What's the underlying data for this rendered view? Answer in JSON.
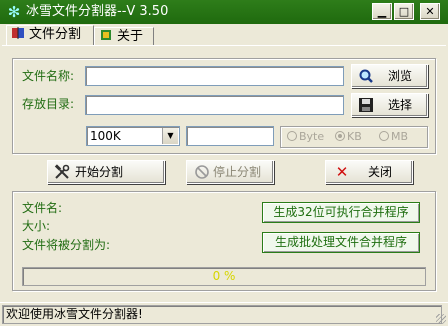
{
  "window": {
    "title": "冰雪文件分割器--V 3.50",
    "title_icon": "snowflake-icon"
  },
  "title_buttons": {
    "minimize": "▁",
    "maximize": "□",
    "close": "✕"
  },
  "tabs": [
    {
      "label": "文件分割",
      "icon": "split-file-icon",
      "active": true
    },
    {
      "label": "关于",
      "icon": "about-icon",
      "active": false
    }
  ],
  "split": {
    "file_name_label": "文件名称:",
    "file_name_value": "",
    "save_dir_label": "存放目录:",
    "save_dir_value": "",
    "browse_label": "浏览",
    "select_label": "选择",
    "size_select_value": "100K",
    "custom_size_value": "",
    "units": [
      {
        "label": "Byte",
        "checked": false
      },
      {
        "label": "KB",
        "checked": true
      },
      {
        "label": "MB",
        "checked": false
      }
    ]
  },
  "actions": {
    "start_label": "开始分割",
    "stop_label": "停止分割",
    "close_label": "关闭"
  },
  "info": {
    "filename_label": "文件名:",
    "size_label": "大小:",
    "parts_label": "文件将被分割为:",
    "gen_exe_label": "生成32位可执行合并程序",
    "gen_bat_label": "生成批处理文件合并程序"
  },
  "progress": {
    "value": 0,
    "text": "0 %"
  },
  "status": {
    "text": "欢迎使用冰雪文件分割器!"
  },
  "colors": {
    "titlebar": "#1f6a0e",
    "label_green": "#216c12",
    "progress_text": "#d6d600"
  }
}
